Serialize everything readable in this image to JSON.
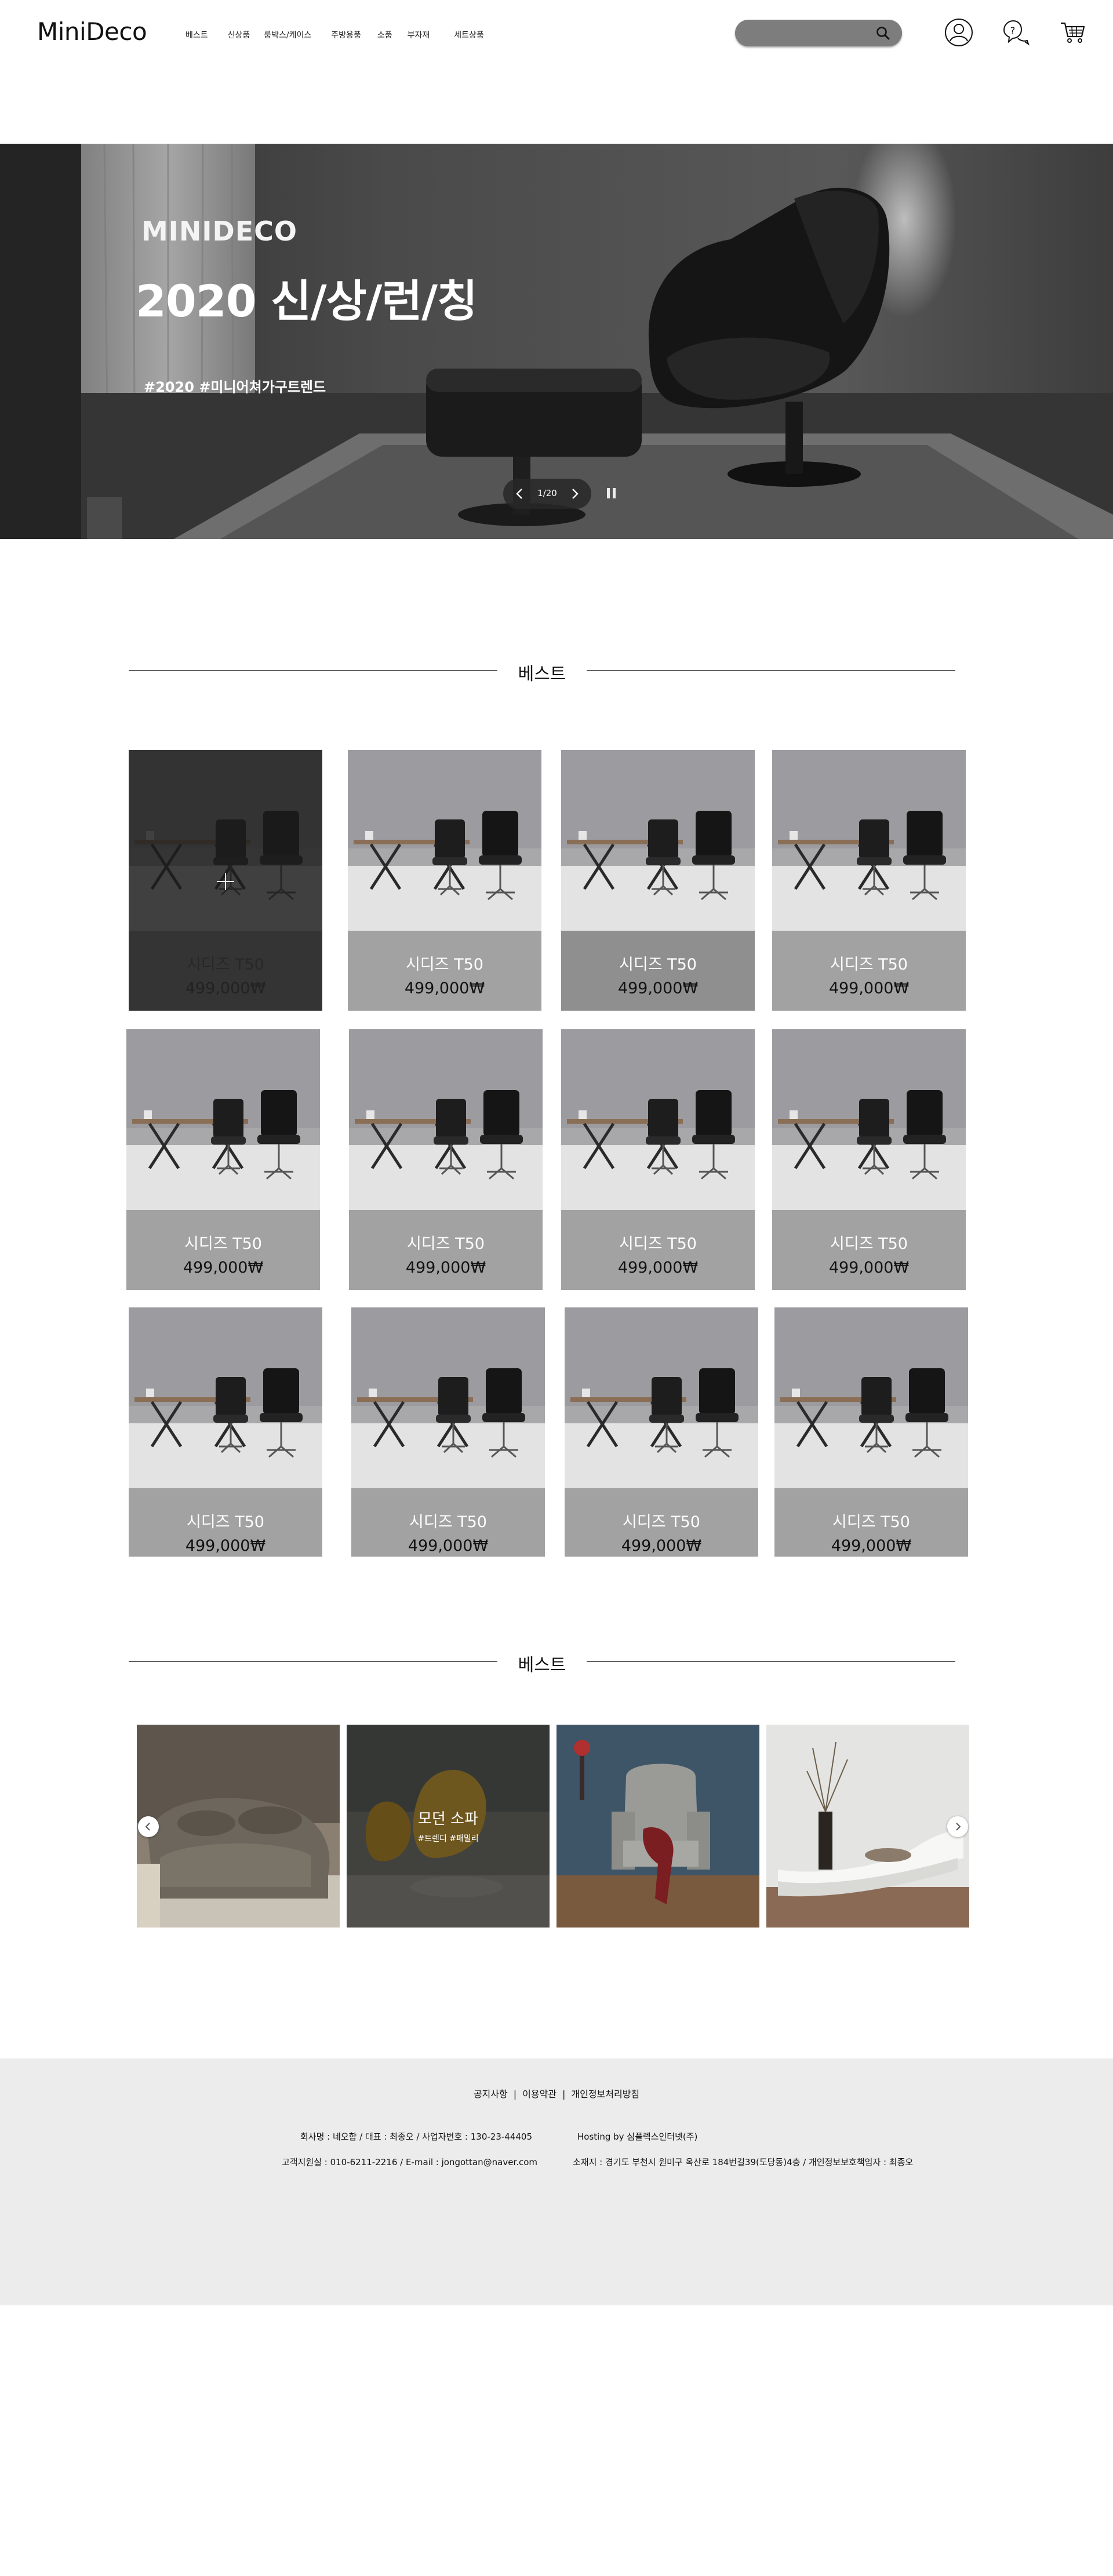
{
  "header": {
    "logo": "MiniDeco",
    "nav": [
      "베스트",
      "신상품",
      "룸박스/케이스",
      "주방용품",
      "소품",
      "부자재",
      "세트상품"
    ],
    "search": {
      "value": "",
      "placeholder": ""
    },
    "icons": [
      "user-icon",
      "help-chat-icon",
      "cart-icon"
    ]
  },
  "hero": {
    "brand": "MINIDECO",
    "title": "2020 신/상/런/칭",
    "tags": "#2020 #미니어쳐가구트렌드",
    "counter": "1/20"
  },
  "best_section": {
    "title": "베스트",
    "products": [
      {
        "name": "시디즈 T50",
        "price": "499,000₩"
      },
      {
        "name": "시디즈 T50",
        "price": "499,000₩"
      },
      {
        "name": "시디즈 T50",
        "price": "499,000₩"
      },
      {
        "name": "시디즈 T50",
        "price": "499,000₩"
      },
      {
        "name": "시디즈 T50",
        "price": "499,000₩"
      },
      {
        "name": "시디즈 T50",
        "price": "499,000₩"
      },
      {
        "name": "시디즈 T50",
        "price": "499,000₩"
      },
      {
        "name": "시디즈 T50",
        "price": "499,000₩"
      },
      {
        "name": "시디즈 T50",
        "price": "499,000₩"
      },
      {
        "name": "시디즈 T50",
        "price": "499,000₩"
      },
      {
        "name": "시디즈 T50",
        "price": "499,000₩"
      },
      {
        "name": "시디즈 T50",
        "price": "499,000₩"
      }
    ]
  },
  "carousel_section": {
    "title": "베스트",
    "tiles": [
      {
        "scene": "sofa-armchair"
      },
      {
        "scene": "yellow-lounge-chair",
        "title": "모던 소파",
        "tags": "#트렌디 #패밀리"
      },
      {
        "scene": "wingback-chair"
      },
      {
        "scene": "white-chaise-lounge"
      }
    ]
  },
  "footer": {
    "links": [
      "공지사항",
      "이용약관",
      "개인정보처리방침"
    ],
    "company": "회사명 : 네오함 / 대표 : 최종오 / 사업자번호 : 130-23-44405",
    "hosting": "Hosting by 심플렉스인터넷(주)",
    "contact": "고객지원실 : 010-6211-2216 / E-mail : jongottan@naver.com",
    "address": "소재지 : 경기도 부천시 원미구 옥산로 184번길39(도당동)4층 / 개인정보보호책임자 : 최종오"
  },
  "colors": {
    "search_bg": "#7d7d7d",
    "card_info": "#a2a2a2",
    "footer_bg": "#ececec",
    "hero_overlay": "#2a2a2a"
  }
}
